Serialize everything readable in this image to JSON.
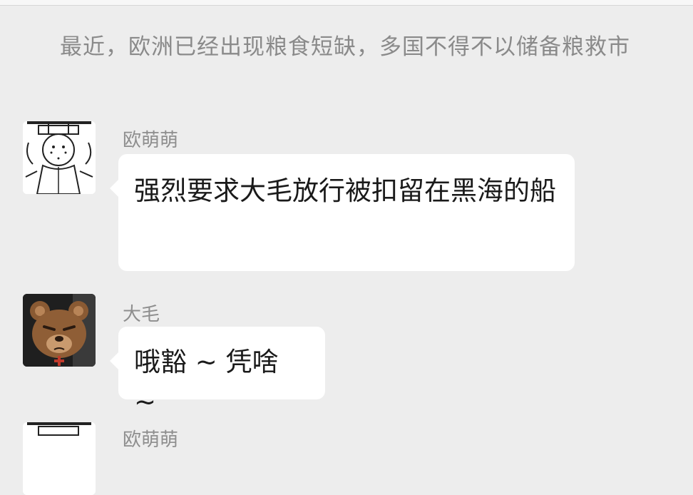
{
  "system_note": "最近，欧洲已经出现粮食短缺，多国不得不以储备粮救市",
  "messages": [
    {
      "sender": "欧萌萌",
      "text": "强烈要求大毛放行被扣留在黑海的船",
      "avatar": "doodle-character-avatar"
    },
    {
      "sender": "大毛",
      "text": "哦豁 ~ 凭啥 ~",
      "avatar": "bear-avatar"
    },
    {
      "sender": "欧萌萌",
      "text": "",
      "avatar": "doodle-character-avatar"
    }
  ]
}
